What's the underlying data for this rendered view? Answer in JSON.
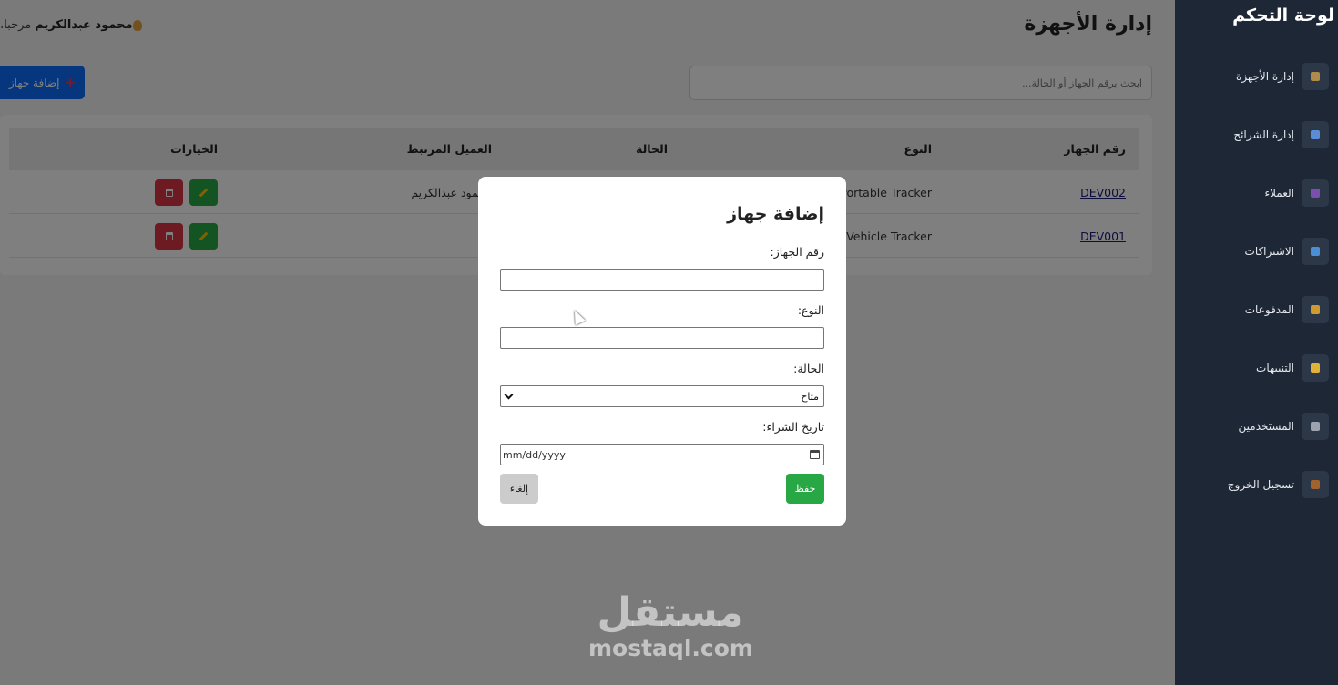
{
  "sidebar": {
    "title": "لوحة التحكم",
    "items": [
      {
        "label": "إدارة الأجهزة",
        "icon": "box-icon",
        "color": "#b08a4a"
      },
      {
        "label": "إدارة الشرائح",
        "icon": "bar-chart-icon",
        "color": "#5b8dd6"
      },
      {
        "label": "العملاء",
        "icon": "users-icon",
        "color": "#7a4fb0"
      },
      {
        "label": "الاشتراكات",
        "icon": "credit-card-icon",
        "color": "#4a8ed6"
      },
      {
        "label": "المدفوعات",
        "icon": "money-bag-icon",
        "color": "#d19a2f"
      },
      {
        "label": "التنبيهات",
        "icon": "bell-icon",
        "color": "#e0b23a"
      },
      {
        "label": "المستخدمين",
        "icon": "tools-icon",
        "color": "#9aa3af"
      },
      {
        "label": "تسجيل الخروج",
        "icon": "door-icon",
        "color": "#a0632e"
      }
    ]
  },
  "header": {
    "title": "إدارة الأجهزة",
    "welcome_prefix": "مرحبا،",
    "user_name": "محمود عبدالكريم"
  },
  "toolbar": {
    "add_label": "إضافة جهاز",
    "add_plus": "+",
    "search_placeholder": "ابحث برقم الجهاز أو الحالة..."
  },
  "table": {
    "headers": {
      "device_no": "رقم الجهاز",
      "type": "النوع",
      "status": "الحالة",
      "client": "العميل المرتبط",
      "options": "الخيارات"
    },
    "rows": [
      {
        "device_no": "DEV002",
        "type": "Portable Tracker",
        "client": "محمود عبدالكريم"
      },
      {
        "device_no": "DEV001",
        "type": "Vehicle Tracker",
        "client": "-"
      }
    ]
  },
  "modal": {
    "title": "إضافة جهاز",
    "device_no_label": "رقم الجهاز:",
    "type_label": "النوع:",
    "status_label": "الحالة:",
    "status_value": "متاح",
    "purchase_date_label": "تاريخ الشراء:",
    "date_placeholder": "mm/dd/yyyy",
    "save_label": "حفظ",
    "cancel_label": "إلغاء"
  },
  "watermark": {
    "arabic": "مستقل",
    "latin": "mostaql.com"
  }
}
